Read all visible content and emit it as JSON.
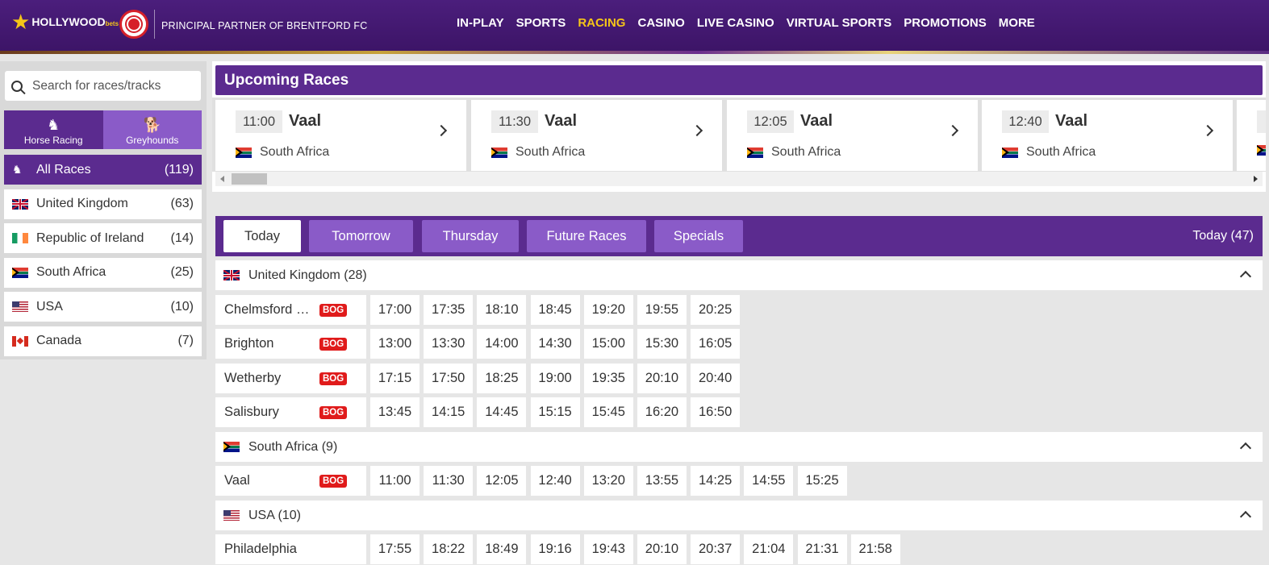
{
  "header": {
    "brand": "HOLLYWOOD",
    "brand_suffix": "bets",
    "partner_text": "PRINCIPAL PARTNER OF BRENTFORD FC",
    "nav": [
      {
        "label": "IN-PLAY",
        "active": false
      },
      {
        "label": "SPORTS",
        "active": false
      },
      {
        "label": "RACING",
        "active": true
      },
      {
        "label": "CASINO",
        "active": false
      },
      {
        "label": "LIVE CASINO",
        "active": false
      },
      {
        "label": "VIRTUAL SPORTS",
        "active": false
      },
      {
        "label": "PROMOTIONS",
        "active": false
      },
      {
        "label": "MORE",
        "active": false
      }
    ]
  },
  "sidebar": {
    "search_placeholder": "Search for races/tracks",
    "toggle": [
      {
        "label": "Horse Racing",
        "icon": "horse-icon"
      },
      {
        "label": "Greyhounds",
        "icon": "greyhound-icon"
      }
    ],
    "countries": [
      {
        "name": "All Races",
        "count": "(119)",
        "flag": "all"
      },
      {
        "name": "United Kingdom",
        "count": "(63)",
        "flag": "uk"
      },
      {
        "name": "Republic of Ireland",
        "count": "(14)",
        "flag": "ie"
      },
      {
        "name": "South Africa",
        "count": "(25)",
        "flag": "za"
      },
      {
        "name": "USA",
        "count": "(10)",
        "flag": "us"
      },
      {
        "name": "Canada",
        "count": "(7)",
        "flag": "ca"
      }
    ]
  },
  "upcoming": {
    "title": "Upcoming Races",
    "races": [
      {
        "time": "11:00",
        "venue": "Vaal",
        "country": "South Africa"
      },
      {
        "time": "11:30",
        "venue": "Vaal",
        "country": "South Africa"
      },
      {
        "time": "12:05",
        "venue": "Vaal",
        "country": "South Africa"
      },
      {
        "time": "12:40",
        "venue": "Vaal",
        "country": "South Africa"
      }
    ]
  },
  "days": {
    "tabs": [
      {
        "label": "Today",
        "active": true
      },
      {
        "label": "Tomorrow",
        "active": false
      },
      {
        "label": "Thursday",
        "active": false
      },
      {
        "label": "Future Races",
        "active": false
      },
      {
        "label": "Specials",
        "active": false
      }
    ],
    "count_label": "Today (47)"
  },
  "bog_label": "BOG",
  "sections": [
    {
      "country": "United Kingdom (28)",
      "flag": "uk",
      "tracks": [
        {
          "name": "Chelmsford City",
          "times": [
            "17:00",
            "17:35",
            "18:10",
            "18:45",
            "19:20",
            "19:55",
            "20:25"
          ]
        },
        {
          "name": "Brighton",
          "times": [
            "13:00",
            "13:30",
            "14:00",
            "14:30",
            "15:00",
            "15:30",
            "16:05"
          ]
        },
        {
          "name": "Wetherby",
          "times": [
            "17:15",
            "17:50",
            "18:25",
            "19:00",
            "19:35",
            "20:10",
            "20:40"
          ]
        },
        {
          "name": "Salisbury",
          "times": [
            "13:45",
            "14:15",
            "14:45",
            "15:15",
            "15:45",
            "16:20",
            "16:50"
          ]
        }
      ]
    },
    {
      "country": "South Africa (9)",
      "flag": "za",
      "tracks": [
        {
          "name": "Vaal",
          "times": [
            "11:00",
            "11:30",
            "12:05",
            "12:40",
            "13:20",
            "13:55",
            "14:25",
            "14:55",
            "15:25"
          ]
        }
      ]
    },
    {
      "country": "USA (10)",
      "flag": "us",
      "tracks": [
        {
          "name": "Philadelphia",
          "times": [
            "17:55",
            "18:22",
            "18:49",
            "19:16",
            "19:43",
            "20:10",
            "20:37",
            "21:04",
            "21:31",
            "21:58"
          ]
        }
      ]
    }
  ]
}
